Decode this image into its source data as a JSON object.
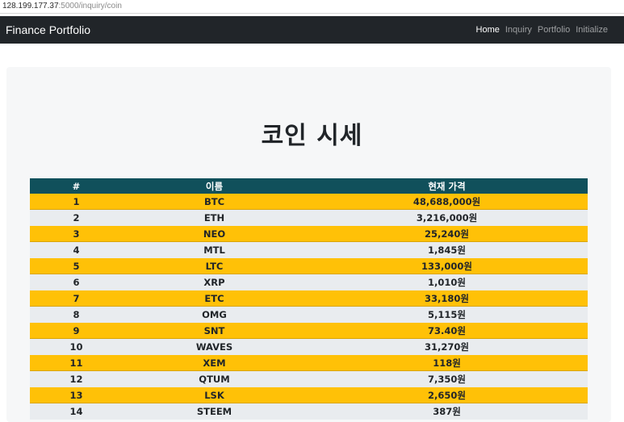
{
  "browser": {
    "url_host": "128.199.177.37",
    "url_path": ":5000/inquiry/coin"
  },
  "navbar": {
    "brand": "Finance Portfolio",
    "links": [
      "Home",
      "Inquiry",
      "Portfolio",
      "Initialize"
    ],
    "active_link": "Home"
  },
  "page": {
    "title": "코인 시세"
  },
  "table": {
    "headers": [
      "#",
      "이름",
      "현재 가격"
    ],
    "rows": [
      {
        "num": "1",
        "name": "BTC",
        "price": "48,688,000원"
      },
      {
        "num": "2",
        "name": "ETH",
        "price": "3,216,000원"
      },
      {
        "num": "3",
        "name": "NEO",
        "price": "25,240원"
      },
      {
        "num": "4",
        "name": "MTL",
        "price": "1,845원"
      },
      {
        "num": "5",
        "name": "LTC",
        "price": "133,000원"
      },
      {
        "num": "6",
        "name": "XRP",
        "price": "1,010원"
      },
      {
        "num": "7",
        "name": "ETC",
        "price": "33,180원"
      },
      {
        "num": "8",
        "name": "OMG",
        "price": "5,115원"
      },
      {
        "num": "9",
        "name": "SNT",
        "price": "73.40원"
      },
      {
        "num": "10",
        "name": "WAVES",
        "price": "31,270원"
      },
      {
        "num": "11",
        "name": "XEM",
        "price": "118원"
      },
      {
        "num": "12",
        "name": "QTUM",
        "price": "7,350원"
      },
      {
        "num": "13",
        "name": "LSK",
        "price": "2,650원"
      },
      {
        "num": "14",
        "name": "STEEM",
        "price": "387원"
      }
    ]
  },
  "colors": {
    "navbar_bg": "#212529",
    "table_header_bg": "#10505b",
    "odd_row_bg": "#ffc107",
    "even_row_bg": "#e9ecef",
    "jumbotron_bg": "#f6f7f8"
  }
}
